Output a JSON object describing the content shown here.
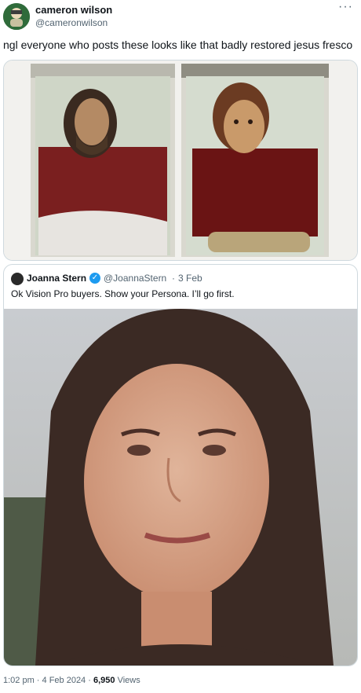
{
  "tweet": {
    "author_name": "cameron wilson",
    "author_handle": "@cameronwilson",
    "more_label": "···",
    "text": "ngl everyone who posts these looks like that badly restored jesus fresco",
    "timestamp": "1:02 pm · 4 Feb 2024",
    "separator": "·",
    "views_count": "6,950",
    "views_label": "Views"
  },
  "quoted_tweet": {
    "author_name": "Joanna Stern",
    "author_handle": "@JoannaStern",
    "separator": "·",
    "date": "3 Feb",
    "text": "Ok Vision Pro buyers. Show your Persona. I’ll go first."
  },
  "colors": {
    "text_primary": "#0f1419",
    "text_secondary": "#536471",
    "border": "#cfd9de",
    "verified": "#1d9bf0"
  }
}
